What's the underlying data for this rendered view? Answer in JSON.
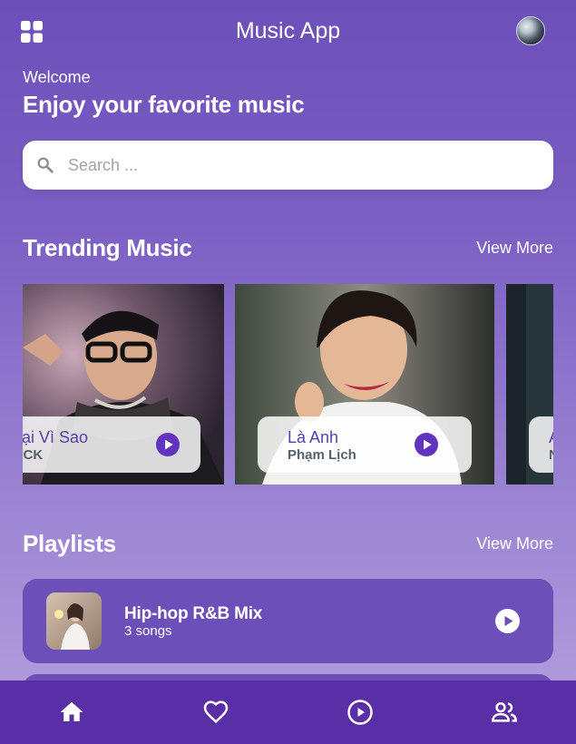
{
  "app": {
    "title": "Music App"
  },
  "header": {
    "welcome": "Welcome",
    "subtitle": "Enjoy your favorite music"
  },
  "search": {
    "placeholder": "Search ...",
    "value": ""
  },
  "trending": {
    "title": "Trending Music",
    "view_more": "View More",
    "cards": [
      {
        "song": "Tại Vì Sao",
        "artist": "MCK",
        "icon": "play-circle-icon"
      },
      {
        "song": "Là Anh",
        "artist": "Phạm Lịch",
        "icon": "play-circle-icon"
      },
      {
        "song": "A",
        "artist": "N",
        "icon": "play-circle-icon"
      }
    ]
  },
  "playlists": {
    "title": "Playlists",
    "view_more": "View More",
    "items": [
      {
        "name": "Hip-hop R&B Mix",
        "count": "3 songs",
        "icon": "play-circle-icon"
      }
    ]
  },
  "nav": {
    "items": [
      {
        "icon": "home-icon",
        "active": true
      },
      {
        "icon": "heart-icon",
        "active": false
      },
      {
        "icon": "play-circle-icon",
        "active": false
      },
      {
        "icon": "people-icon",
        "active": false
      }
    ]
  },
  "colors": {
    "accent": "#6c4fb9",
    "nav_background": "#5a2ea6",
    "card_text": "#5b3fae",
    "artist_text": "#56616b"
  }
}
